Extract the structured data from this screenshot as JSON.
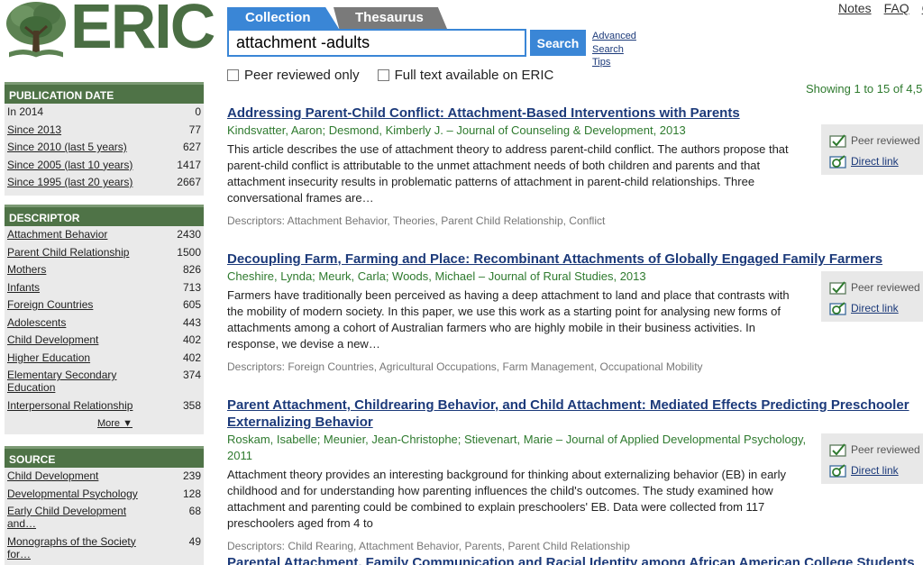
{
  "brand": {
    "name": "ERIC"
  },
  "top_links": [
    "Notes",
    "FAQ",
    "C"
  ],
  "tabs": [
    {
      "label": "Collection",
      "active": true
    },
    {
      "label": "Thesaurus",
      "active": false
    }
  ],
  "search": {
    "value": "attachment -adults",
    "button": "Search",
    "advanced_lines": [
      "Advanced",
      "Search",
      "Tips"
    ]
  },
  "filters": {
    "peer": "Peer reviewed only",
    "fulltext": "Full text available on ERIC"
  },
  "showing": "Showing 1 to 15 of 4,5",
  "facets": {
    "publication_date": {
      "header": "PUBLICATION DATE",
      "items": [
        {
          "label": "In 2014",
          "count": "0",
          "link": false
        },
        {
          "label": "Since 2013",
          "count": "77",
          "link": true
        },
        {
          "label": "Since 2010 (last 5 years)",
          "count": "627",
          "link": true
        },
        {
          "label": "Since 2005 (last 10 years)",
          "count": "1417",
          "link": true
        },
        {
          "label": "Since 1995 (last 20 years)",
          "count": "2667",
          "link": true
        }
      ]
    },
    "descriptor": {
      "header": "DESCRIPTOR",
      "items": [
        {
          "label": "Attachment Behavior",
          "count": "2430"
        },
        {
          "label": "Parent Child Relationship",
          "count": "1500"
        },
        {
          "label": "Mothers",
          "count": "826"
        },
        {
          "label": "Infants",
          "count": "713"
        },
        {
          "label": "Foreign Countries",
          "count": "605"
        },
        {
          "label": "Adolescents",
          "count": "443"
        },
        {
          "label": "Child Development",
          "count": "402"
        },
        {
          "label": "Higher Education",
          "count": "402"
        },
        {
          "label": "Elementary Secondary Education",
          "count": "374"
        },
        {
          "label": "Interpersonal Relationship",
          "count": "358"
        }
      ],
      "more": "More ▼"
    },
    "source": {
      "header": "SOURCE",
      "items": [
        {
          "label": "Child Development",
          "count": "239"
        },
        {
          "label": "Developmental Psychology",
          "count": "128"
        },
        {
          "label": "Early Child Development and…",
          "count": "68"
        },
        {
          "label": "Monographs of the Society for…",
          "count": "49"
        }
      ]
    }
  },
  "result_labels": {
    "peer": "Peer reviewed",
    "direct": "Direct link"
  },
  "results": [
    {
      "title": [
        "Addressing Parent-Child Conflict: Attachment-Based Interventions with Parents"
      ],
      "authors": "Kindsvatter, Aaron; Desmond, Kimberly J. – Journal of Counseling & Development, 2013",
      "abstract": "This article describes the use of attachment theory to address parent-child conflict. The authors propose that parent-child conflict is attributable to the unmet attachment needs of both children and parents and that attachment insecurity results in problematic patterns of attachment in parent-child relationships. Three conversational frames are…",
      "descriptors": "Descriptors: Attachment Behavior, Theories, Parent Child Relationship, Conflict"
    },
    {
      "title": [
        "Decoupling Farm, Farming and Place: Recombinant Attachments of Globally Engaged Family Farmers"
      ],
      "authors": "Cheshire, Lynda; Meurk, Carla; Woods, Michael – Journal of Rural Studies, 2013",
      "abstract": "Farmers have traditionally been perceived as having a deep attachment to land and place that contrasts with the mobility of modern society. In this paper, we use this work as a starting point for analysing new forms of attachments among a cohort of Australian farmers who are highly mobile in their business activities. In response, we devise a new…",
      "descriptors": "Descriptors: Foreign Countries, Agricultural Occupations, Farm Management, Occupational Mobility"
    },
    {
      "title": [
        "Parent Attachment, Childrearing Behavior, and Child Attachment: Mediated Effects Predicting Preschooler",
        "Externalizing Behavior"
      ],
      "authors": "Roskam, Isabelle; Meunier, Jean-Christophe; Stievenart, Marie – Journal of Applied Developmental Psychology, 2011",
      "abstract": "Attachment theory provides an interesting background for thinking about externalizing behavior (EB) in early childhood and for understanding how parenting influences the child's outcomes. The study examined how attachment and parenting could be combined to explain preschoolers' EB. Data were collected from 117 preschoolers aged from 4 to",
      "descriptors": "Descriptors: Child Rearing, Attachment Behavior, Parents, Parent Child Relationship"
    }
  ],
  "partial_title": "Parental Attachment, Family Communication and Racial Identity among African American College Students"
}
